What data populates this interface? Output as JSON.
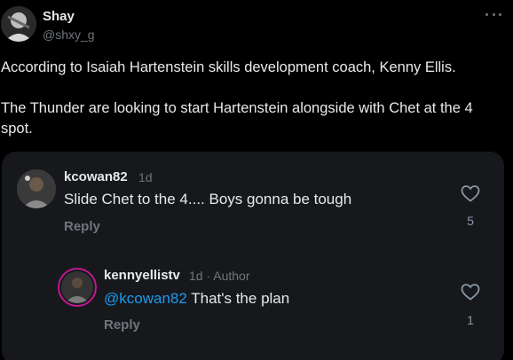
{
  "author": {
    "name": "Shay",
    "handle": "@shxy_g"
  },
  "post": {
    "paragraph1": "According to Isaiah Hartenstein skills development coach, Kenny Ellis.",
    "paragraph2": "The Thunder are looking to start Hartenstein alongside with Chet at the 4 spot."
  },
  "thread": {
    "comment1": {
      "username": "kcowan82",
      "time": "1d",
      "text": "Slide Chet to the 4.... Boys gonna be tough",
      "reply_label": "Reply",
      "likes": "5"
    },
    "comment2": {
      "username": "kennyellistv",
      "meta": "1d · Author",
      "mention": "@kcowan82",
      "text": " That's the plan",
      "reply_label": "Reply",
      "likes": "1"
    }
  },
  "colors": {
    "background": "#000000",
    "card": "#16181c",
    "text": "#e7e9ea",
    "muted": "#71767b",
    "mention": "#1d9bf0",
    "story_ring": "#c1188e"
  },
  "icons": [
    "more-options-icon",
    "heart-icon"
  ]
}
